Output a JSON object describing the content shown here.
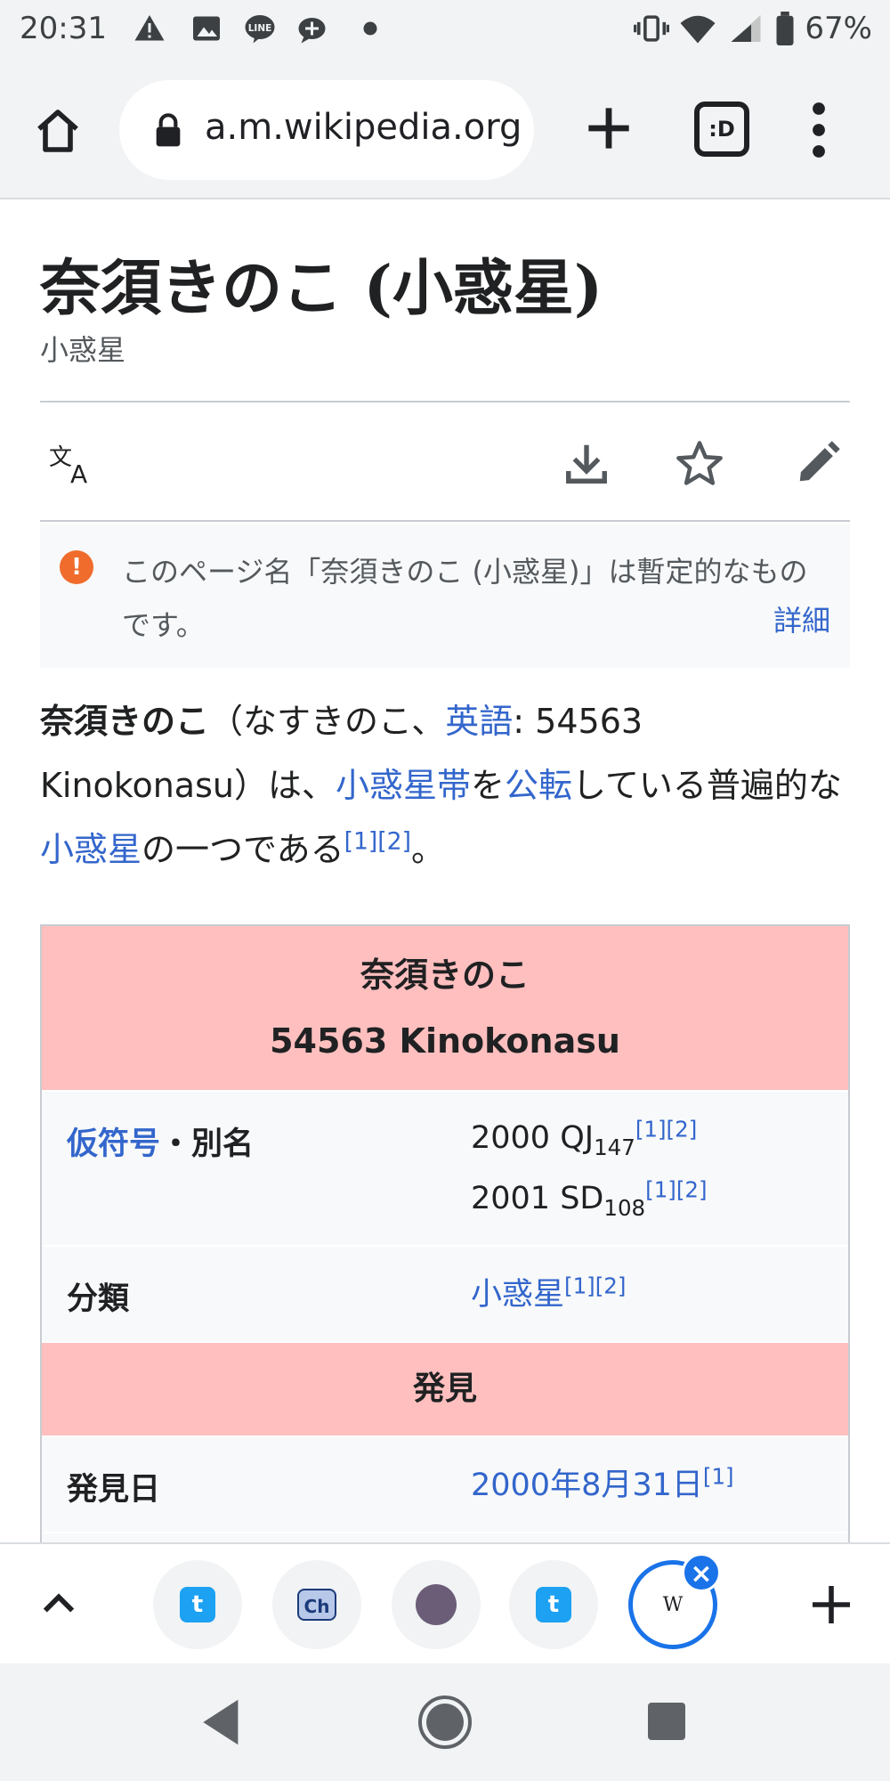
{
  "status": {
    "time": "20:31",
    "battery": "67%"
  },
  "browser": {
    "url": "a.m.wikipedia.org",
    "tab_switcher_label": ":D"
  },
  "page": {
    "title": "奈須きのこ (小惑星)",
    "subtitle": "小惑星",
    "notice_text": "このページ名「奈須きのこ (小惑星)」は暫定的なものです。",
    "notice_more": "詳細"
  },
  "lead": {
    "bold": "奈須きのこ",
    "t1": "（なすきのこ、",
    "l1": "英語",
    "t2": ": 54563 Kinokonasu）は、",
    "l2": "小惑星帯",
    "t3": "を",
    "l3": "公転",
    "t4": "している普遍的な",
    "l4": "小惑星",
    "t5": "の一つである",
    "refs": "[1][2]",
    "t6": "。"
  },
  "infobox": {
    "name_ja": "奈須きのこ",
    "name_en": "54563 Kinokonasu",
    "row1_label_link": "仮符号",
    "row1_label_rest": "・別名",
    "row1_val1": "2000 QJ",
    "row1_sub1": "147",
    "row1_val2": "2001 SD",
    "row1_sub2": "108",
    "refs": "[1][2]",
    "row2_label": "分類",
    "row2_val": "小惑星",
    "section": "発見",
    "row3_label": "発見日",
    "row3_val": "2000年8月31日",
    "row3_ref": "[1]"
  },
  "tabstrip": {
    "active_tab_label": "W"
  }
}
